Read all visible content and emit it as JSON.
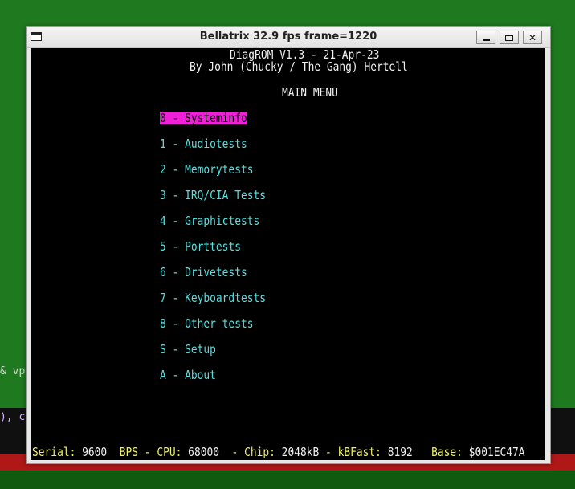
{
  "desktop": {
    "left_text_1": "& vp",
    "left_text_2": "), co"
  },
  "window": {
    "title": "Bellatrix  32.9 fps  frame=1220",
    "buttons": {
      "minimize": "_",
      "maximize": "□",
      "close": "✕"
    }
  },
  "screen": {
    "header_line_1": "DiagROM V1.3 - 21-Apr-23",
    "header_line_2": "By John (Chucky / The Gang) Hertell",
    "menu_title": "MAIN MENU",
    "menu_items": [
      {
        "label": "0 - Systeminfo",
        "selected": true
      },
      {
        "label": "1 - Audiotests",
        "selected": false
      },
      {
        "label": "2 - Memorytests",
        "selected": false
      },
      {
        "label": "3 - IRQ/CIA Tests",
        "selected": false
      },
      {
        "label": "4 - Graphictests",
        "selected": false
      },
      {
        "label": "5 - Porttests",
        "selected": false
      },
      {
        "label": "6 - Drivetests",
        "selected": false
      },
      {
        "label": "7 - Keyboardtests",
        "selected": false
      },
      {
        "label": "8 - Other tests",
        "selected": false
      },
      {
        "label": "S - Setup",
        "selected": false
      },
      {
        "label": "A - About",
        "selected": false
      }
    ],
    "status": {
      "serial_label": "Serial:",
      "serial_value": " 9600",
      "bps_label": "  BPS - CPU:",
      "cpu_value": " 68000",
      "chip_label": "  - Chip:",
      "chip_value": " 2048kB",
      "kbfast_label": " - kBFast:",
      "kbfast_value": " 8192",
      "base_label": "   Base:",
      "base_value": " $001EC47A"
    },
    "colors": {
      "menu_text": "#55e0e0",
      "selected_bg": "#f020d8",
      "status_label": "#f0f060",
      "header_text": "#f0f0f0"
    }
  }
}
